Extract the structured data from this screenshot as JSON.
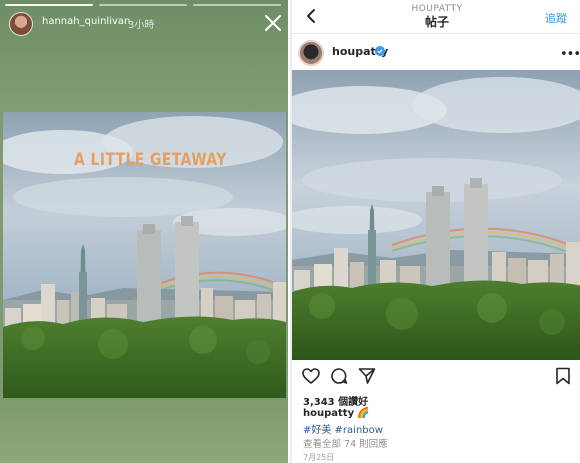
{
  "story": {
    "username": "hannah_quinlivan",
    "time": "3小時",
    "overlay_text": "A LITTLE GETAWAY",
    "close_icon": "close-icon",
    "progress_segments": 3,
    "progress_active_index": 0
  },
  "post": {
    "nav": {
      "back_icon": "chevron-left-icon",
      "username": "HOUPATTY",
      "title": "帖子",
      "follow_label": "追蹤"
    },
    "author": "houpatty",
    "verified_icon": "verified-badge-icon",
    "more_icon": "more-options-icon",
    "actions": [
      "heart-icon",
      "comment-icon",
      "share-icon",
      "bookmark-icon"
    ],
    "likes": "3,343 個讚好",
    "caption_user": "houpatty",
    "caption_emoji": "🌈",
    "tags": "#好美 #rainbow",
    "view_comments": "查看全部 74 則回應",
    "date": "7月25日"
  },
  "colors": {
    "link_blue": "#3897f0",
    "hashtag_blue": "#2b5b9b",
    "overlay_text_orange": "#e2a066",
    "verified_blue": "#3897f0"
  }
}
